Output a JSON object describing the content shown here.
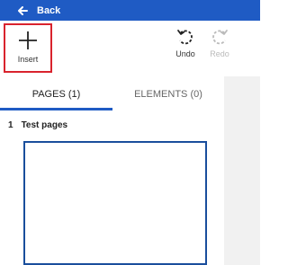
{
  "header": {
    "back_label": "Back",
    "back_icon": "arrow-left-icon",
    "background_color": "#1f5bc4"
  },
  "toolbar": {
    "insert": {
      "label": "Insert",
      "icon": "plus-icon",
      "highlight_color": "#d9232d"
    },
    "undo": {
      "label": "Undo",
      "icon": "undo-icon",
      "enabled": true
    },
    "redo": {
      "label": "Redo",
      "icon": "redo-icon",
      "enabled": false
    }
  },
  "tabs": [
    {
      "label": "PAGES (1)",
      "active": true
    },
    {
      "label": "ELEMENTS (0)",
      "active": false
    }
  ],
  "pages": [
    {
      "number": "1",
      "title": "Test pages"
    }
  ],
  "colors": {
    "accent": "#1f5bc4",
    "thumbnail_border": "#1a4e9c",
    "side_panel": "#f1f1f1"
  }
}
